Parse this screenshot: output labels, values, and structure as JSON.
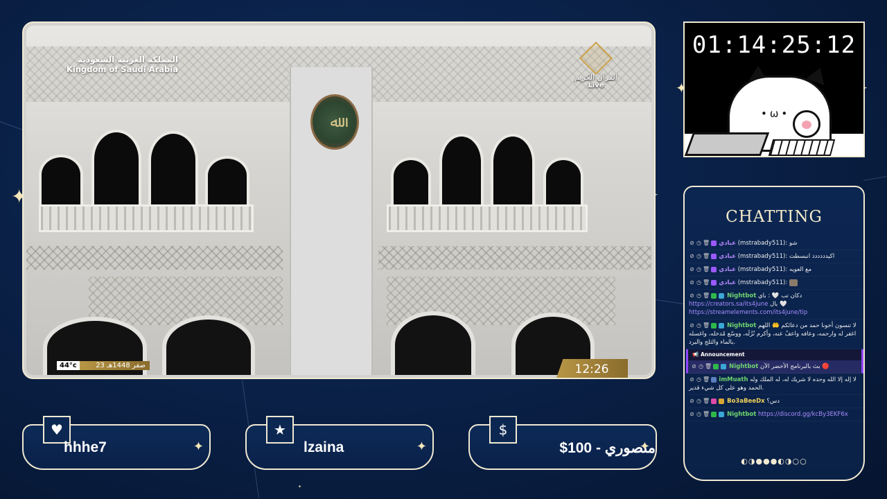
{
  "video": {
    "country_ar": "المملكة العربية السعودية",
    "country_en": "Kingdom of Saudi Arabia",
    "channel_name": "القرآن الكريم",
    "live_label": "Live",
    "temperature": "44°c",
    "date_hijri": "23 صفر 1448هـ",
    "clock": "12:26"
  },
  "timer": {
    "value": "01:14:25:12"
  },
  "chat": {
    "title": "CHATTING",
    "messages": [
      {
        "user": "عبادي",
        "handle": "(mstrabady511)",
        "text": ": شو"
      },
      {
        "user": "عبادي",
        "handle": "(mstrabady511)",
        "text": ": اكيدددددد انبسطت"
      },
      {
        "user": "عبادي",
        "handle": "(mstrabady511)",
        "text": ": مع العويه"
      },
      {
        "user": "عبادي",
        "handle": "(mstrabady511)",
        "text": ":"
      },
      {
        "user": "Nightbot",
        "text": "دكان تب 🤍 : باي",
        "link": "https://creators.sa/its4june",
        "text2": "بال 🤍",
        "link2": "https://streamelements.com/its4june/tip"
      },
      {
        "user": "Nightbot",
        "text": "لا تنسون أخونا حمد من دعائكم 🤲 اللهم اغفر له وارحمه، وعافه واعفُ عنه، وأكرم نُزُلَه، ووسّع مُدخله، واغسله بالماء والثلج والبرد."
      },
      {
        "announcement": "Announcement",
        "user": "Nightbot",
        "text": "بث بالبرنامج الأخضر الآن 🔴"
      },
      {
        "user": "imMuath",
        "text": "لا إله إلا الله وحده لا شريك له، له الملك وله الحمد وهو على كل شيء قدير."
      },
      {
        "user": "Bo3aBeeDx",
        "text": "دس؟"
      },
      {
        "user": "Nightbot",
        "link": "https://discord.gg/kcBy3EKF6x"
      }
    ],
    "scroll_indicator": "◐◑●●●◐◑○○"
  },
  "alerts": [
    {
      "icon": "heart-icon",
      "glyph": "♥",
      "label": "hhhe7"
    },
    {
      "icon": "star-icon",
      "glyph": "★",
      "label": "lzaina"
    },
    {
      "icon": "dollar-icon",
      "glyph": "$",
      "label": "منصوري - 100$"
    }
  ],
  "colors": {
    "background": "#0a2148",
    "frame": "#f1ead2",
    "gold": "#b89646",
    "announcement": "#9146ff"
  }
}
